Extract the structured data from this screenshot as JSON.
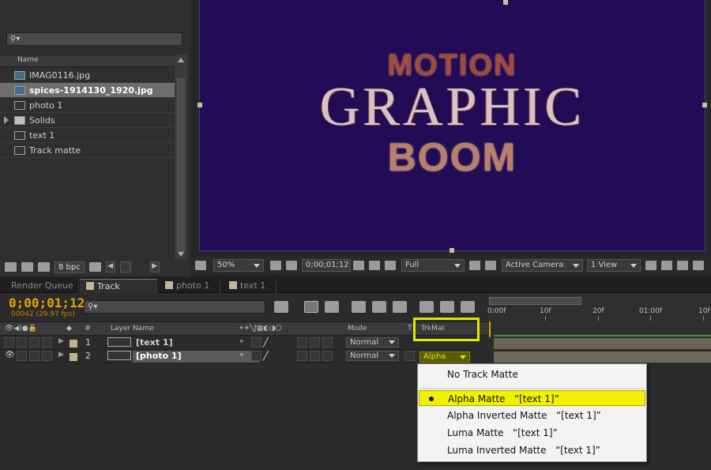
{
  "project": {
    "header_name": "Name",
    "items": [
      {
        "label": "IMAG0116.jpg",
        "type": "image"
      },
      {
        "label": "spices-1914130_1920.jpg",
        "type": "image",
        "selected": true
      },
      {
        "label": "photo 1",
        "type": "comp"
      },
      {
        "label": "Solids",
        "type": "folder"
      },
      {
        "label": "text 1",
        "type": "comp"
      },
      {
        "label": "Track matte",
        "type": "comp"
      }
    ],
    "bpc": "8 bpc"
  },
  "viewer": {
    "title_line1": "MOTION",
    "title_line2": "GRAPHIC",
    "title_line3": "BOOM",
    "zoom": "50%",
    "timecode": "0;00;01;12",
    "resolution": "Full",
    "camera": "Active Camera",
    "view": "1 View"
  },
  "tabs": [
    {
      "label": "Render Queue"
    },
    {
      "label": "Track matte",
      "active": true
    },
    {
      "label": "photo 1"
    },
    {
      "label": "text 1"
    }
  ],
  "timeline": {
    "timecode": "0;00;01;12",
    "fps": "00042 (29.97 fps)",
    "col_hash": "#",
    "col_layer_name": "Layer Name",
    "col_mode": "Mode",
    "col_t": "T",
    "col_trkmat": "TrkMat",
    "ruler_labels": [
      "0:00f",
      "10f",
      "20f",
      "01:00f",
      "10f"
    ],
    "layers": [
      {
        "num": "1",
        "name": "[text 1]",
        "mode": "Normal"
      },
      {
        "num": "2",
        "name": "[photo 1]",
        "mode": "Normal",
        "trkmat": "Alpha"
      }
    ]
  },
  "trkmat_menu": {
    "items": [
      {
        "label": "No Track Matte"
      },
      {
        "label": "Alpha Matte   “[text 1]”",
        "checked": true
      },
      {
        "label": "Alpha Inverted Matte   “[text 1]”"
      },
      {
        "label": "Luma Matte   “[text 1]”"
      },
      {
        "label": "Luma Inverted Matte   “[text 1]”"
      }
    ]
  },
  "colors": {
    "accent_timecode": "#e3a300",
    "highlight_yellow": "#f2f200",
    "comp_background": "#220c56"
  }
}
